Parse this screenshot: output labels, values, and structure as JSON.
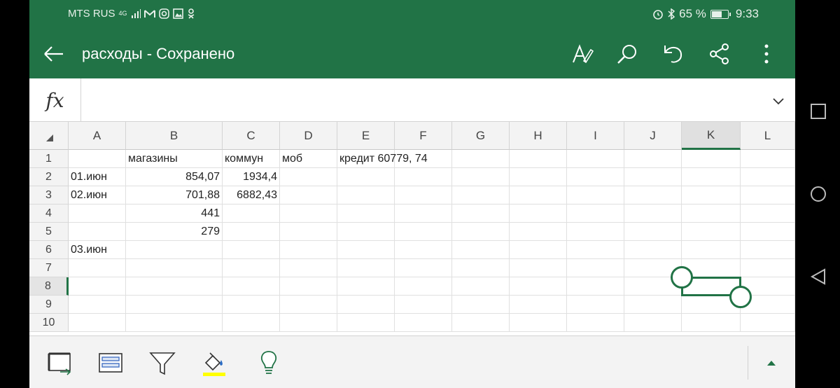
{
  "status_bar": {
    "carrier": "MTS RUS",
    "network": "4G",
    "battery": "65 %",
    "battery_level": 0.65,
    "time": "9:33",
    "icons": [
      "signal-icon",
      "mail-icon",
      "instagram-icon",
      "image-icon",
      "odnoklassniki-icon",
      "alarm-icon",
      "bluetooth-icon",
      "battery-icon"
    ]
  },
  "app_bar": {
    "title": "расходы - Сохранено",
    "actions": [
      "text-format-icon",
      "search-icon",
      "undo-icon",
      "share-icon",
      "more-icon"
    ]
  },
  "formula_bar": {
    "label": "fx",
    "value": ""
  },
  "sheet": {
    "columns": [
      "A",
      "B",
      "C",
      "D",
      "E",
      "F",
      "G",
      "H",
      "I",
      "J",
      "K",
      "L"
    ],
    "selected_column": "K",
    "rows": [
      "1",
      "2",
      "3",
      "4",
      "5",
      "6",
      "7",
      "8",
      "9",
      "10"
    ],
    "selected_row": "8",
    "cells": {
      "B1": "магазины",
      "C1": "коммун",
      "D1": "моб",
      "E1": "кредит 60779, 74",
      "A2": "01.июн",
      "B2": "854,07",
      "C2": "1934,4",
      "A3": "02.июн",
      "B3": "701,88",
      "C3": "6882,43",
      "B4": "441",
      "B5": "279",
      "A6": "03.июн"
    },
    "selected_cell": "K8"
  },
  "toolbar": {
    "buttons": [
      "freeze-panes-icon",
      "format-as-table-icon",
      "filter-icon",
      "fill-color-icon",
      "idea-bulb-icon"
    ],
    "fill_color": "#ffff00",
    "accent": "#217346"
  },
  "nav": {
    "buttons": [
      "recents-square-icon",
      "home-circle-icon",
      "back-triangle-icon"
    ]
  }
}
